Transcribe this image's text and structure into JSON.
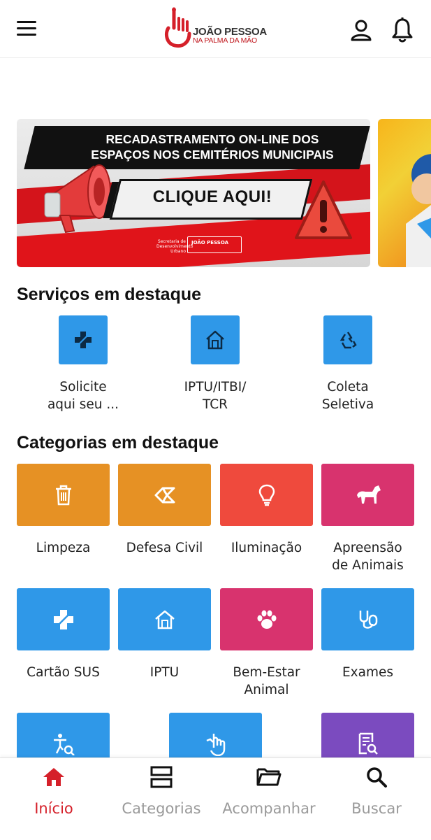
{
  "header": {
    "logo_title": "JOÃO PESSOA",
    "logo_subtitle": "NA PALMA DA MÃO",
    "brand_color": "#d5202a"
  },
  "banner": {
    "headline_line1": "RECADASTRAMENTO ON-LINE DOS",
    "headline_line2": "ESPAÇOS NOS CEMITÉRIOS MUNICIPAIS",
    "cta": "CLIQUE AQUI!",
    "footer_secretaria": "Secretaria de Desenvolvimento Urbano",
    "footer_logo": "JOÃO PESSOA"
  },
  "featured_services": {
    "title": "Serviços em destaque",
    "items": [
      {
        "label_line1": "Solicite",
        "label_line2": "aqui seu ...",
        "icon": "health-cross-icon"
      },
      {
        "label_line1": "IPTU/ITBI/",
        "label_line2": "TCR",
        "icon": "house-icon"
      },
      {
        "label_line1": "Coleta",
        "label_line2": "Seletiva",
        "icon": "recycle-icon"
      }
    ]
  },
  "featured_categories": {
    "title": "Categorias em destaque",
    "items": [
      {
        "line1": "Limpeza",
        "line2": "",
        "color": "#e69124",
        "icon": "trash-icon"
      },
      {
        "line1": "Defesa Civil",
        "line2": "",
        "color": "#e69124",
        "icon": "civil-defense-icon"
      },
      {
        "line1": "Iluminação",
        "line2": "",
        "color": "#ef4a3d",
        "icon": "lightbulb-icon"
      },
      {
        "line1": "Apreensão",
        "line2": "de Animais",
        "color": "#d8336e",
        "icon": "horse-icon"
      },
      {
        "line1": "Cartão SUS",
        "line2": "",
        "color": "#2f98e8",
        "icon": "health-cross-icon"
      },
      {
        "line1": "IPTU",
        "line2": "",
        "color": "#2f98e8",
        "icon": "house-icon"
      },
      {
        "line1": "Bem-Estar",
        "line2": "Animal",
        "color": "#d8336e",
        "icon": "paw-icon"
      },
      {
        "line1": "Exames",
        "line2": "",
        "color": "#2f98e8",
        "icon": "stethoscope-icon"
      },
      {
        "line1": "",
        "line2": "",
        "color": "#2f98e8",
        "icon": "accessibility-search-icon"
      },
      {
        "line1": "",
        "line2": "",
        "color": "#2f98e8",
        "icon": "hand-touch-icon"
      },
      {
        "line1": "",
        "line2": "",
        "color": "#7b4bbf",
        "icon": "document-search-icon"
      }
    ]
  },
  "bottom_nav": {
    "items": [
      {
        "label": "Início",
        "active": true,
        "icon": "home-icon"
      },
      {
        "label": "Categorias",
        "active": false,
        "icon": "categories-icon"
      },
      {
        "label": "Acompanhar",
        "active": false,
        "icon": "folder-icon"
      },
      {
        "label": "Buscar",
        "active": false,
        "icon": "search-icon"
      }
    ]
  }
}
